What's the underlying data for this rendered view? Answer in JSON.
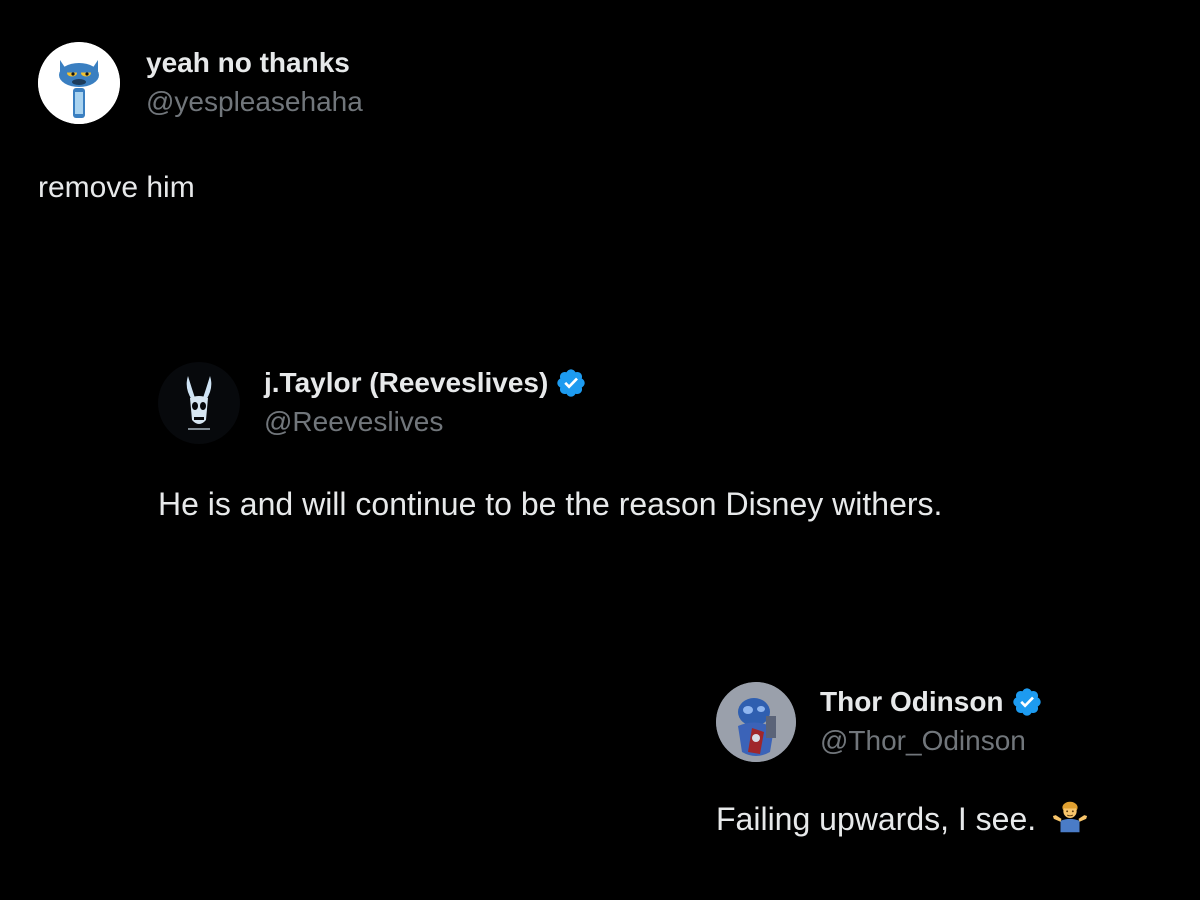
{
  "colors": {
    "background": "#000000",
    "primary_text": "#e7e9ea",
    "secondary_text": "#71767b",
    "verified_blue": "#1d9bf0"
  },
  "tweets": [
    {
      "display_name": "yeah no thanks",
      "handle": "@yespleasehaha",
      "verified": false,
      "avatar_icon": "cartoon-cat-avatar-icon",
      "text": "remove him"
    },
    {
      "display_name": "j.Taylor (Reeveslives)",
      "handle": "@Reeveslives",
      "verified": true,
      "avatar_icon": "bunny-skull-avatar-icon",
      "text": "He is and will continue to be the reason Disney withers."
    },
    {
      "display_name": "Thor Odinson",
      "handle": "@Thor_Odinson",
      "verified": true,
      "avatar_icon": "armored-hero-avatar-icon",
      "text": "Failing upwards, I see.",
      "emoji": "man-shrugging-emoji"
    }
  ]
}
